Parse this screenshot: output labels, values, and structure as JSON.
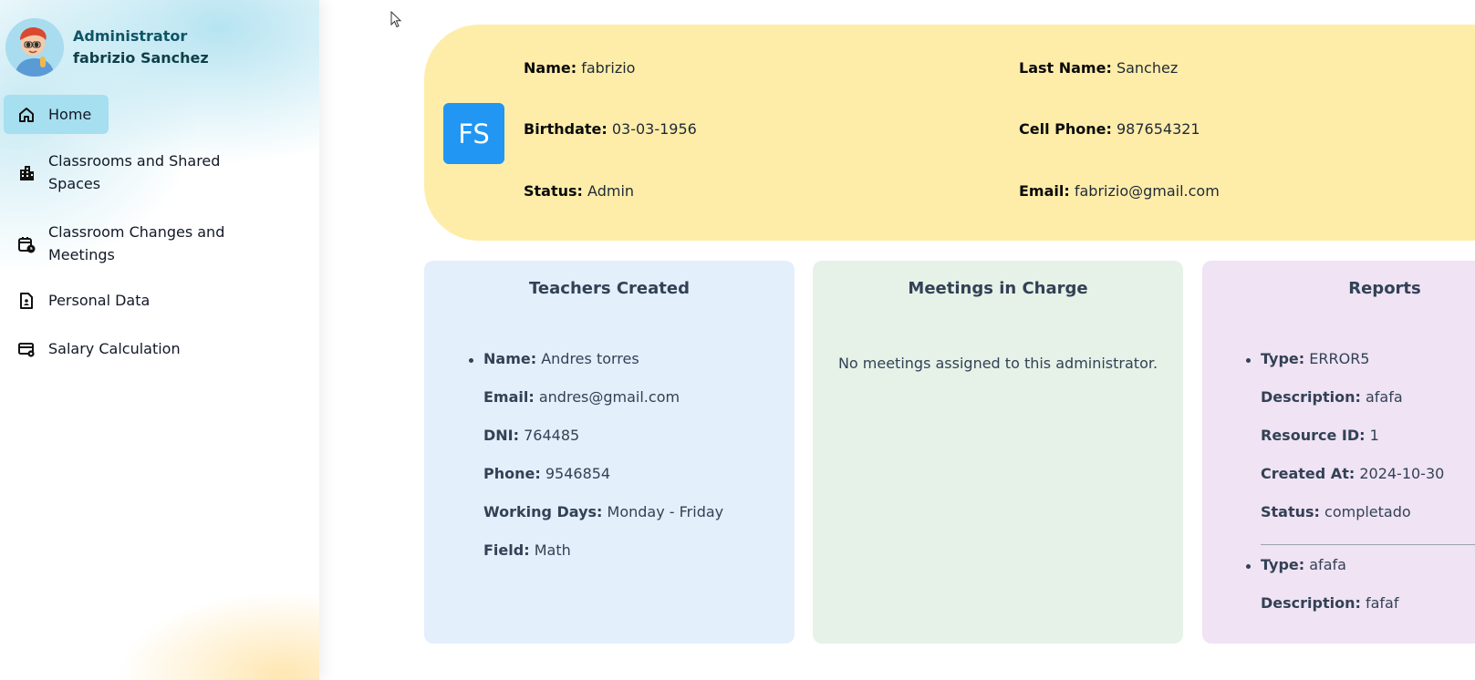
{
  "profile": {
    "role": "Administrator",
    "name": "fabrizio Sanchez"
  },
  "sidebar": {
    "items": [
      {
        "label": "Home",
        "icon": "home-icon",
        "active": true
      },
      {
        "label": "Classrooms and Shared Spaces",
        "icon": "building-icon"
      },
      {
        "label": "Classroom Changes and Meetings",
        "icon": "calendar-clock-icon"
      },
      {
        "label": "Personal Data",
        "icon": "id-document-icon"
      },
      {
        "label": "Salary Calculation",
        "icon": "card-gear-icon"
      }
    ]
  },
  "user_card": {
    "initials": "FS",
    "name_label": "Name:",
    "name_value": "fabrizio",
    "last_name_label": "Last Name:",
    "last_name_value": "Sanchez",
    "birthdate_label": "Birthdate:",
    "birthdate_value": "03-03-1956",
    "phone_label": "Cell Phone:",
    "phone_value": "987654321",
    "status_label": "Status:",
    "status_value": "Admin",
    "email_label": "Email:",
    "email_value": "fabrizio@gmail.com",
    "accent_color": "#2196f3",
    "background_color": "#feeda9"
  },
  "teachers": {
    "title": "Teachers Created",
    "items": [
      {
        "name_label": "Name:",
        "name": "Andres torres",
        "email_label": "Email:",
        "email": "andres@gmail.com",
        "dni_label": "DNI:",
        "dni": "764485",
        "phone_label": "Phone:",
        "phone": "9546854",
        "days_label": "Working Days:",
        "days": "Monday - Friday",
        "field_label": "Field:",
        "field": "Math"
      }
    ]
  },
  "meetings": {
    "title": "Meetings in Charge",
    "empty_message": "No meetings assigned to this administrator."
  },
  "reports": {
    "title": "Reports",
    "items": [
      {
        "type_label": "Type:",
        "type": "ERROR5",
        "description_label": "Description:",
        "description": "afafa",
        "resource_label": "Resource ID:",
        "resource": "1",
        "created_label": "Created At:",
        "created": "2024-10-30",
        "status_label": "Status:",
        "status": "completado"
      },
      {
        "type_label": "Type:",
        "type": "afafa",
        "description_label": "Description:",
        "description": "fafaf"
      }
    ]
  }
}
